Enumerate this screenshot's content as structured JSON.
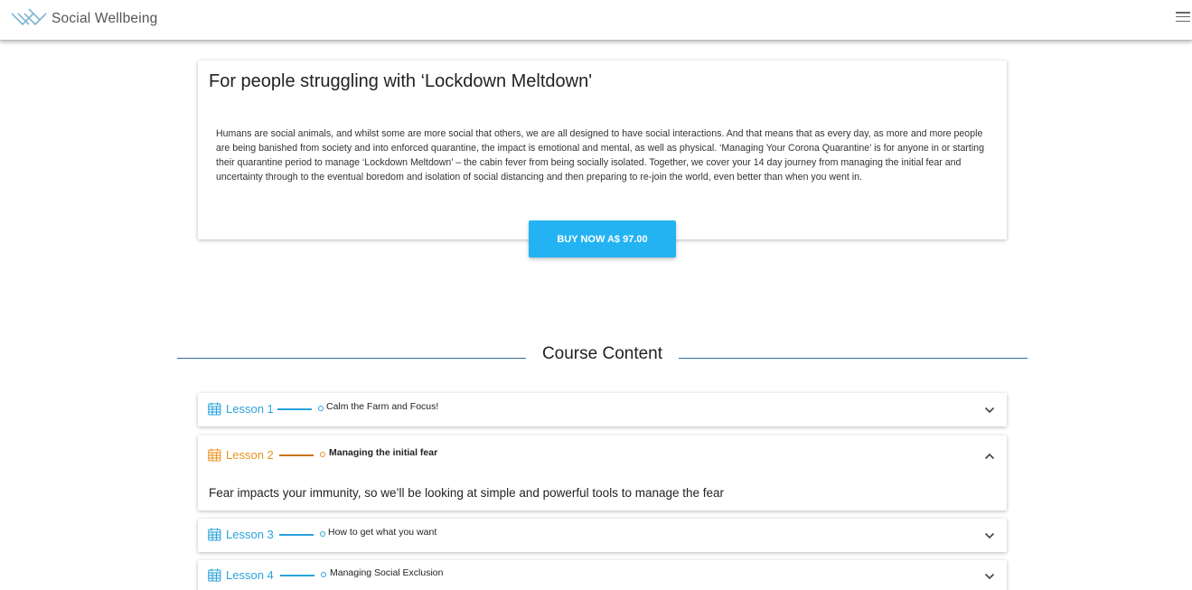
{
  "header": {
    "brand": "Social Wellbeing",
    "logo_icon": "interlocking-chevrons-logo",
    "menu_icon": "hamburger-menu-icon"
  },
  "promo": {
    "title": "For people struggling with ‘Lockdown Meltdown'",
    "body": "Humans are social animals, and whilst some are more social that others, we are all designed to have social interactions. And that means that as every day, as more and more people are being banished from society and into enforced quarantine, the impact is emotional and mental, as well as physical. ‘Managing Your Corona Quarantine’ is for anyone in or starting their quarantine period to manage ‘Lockdown Meltdown’ – the cabin fever from being socially isolated. Together, we cover your 14 day journey from managing the initial fear and uncertainty through to the eventual boredom and isolation of social distancing and then preparing to re-join the world, even better than when you went in.",
    "buy_label": "BUY NOW A$ 97.00"
  },
  "course": {
    "title": "Course Content",
    "lessons": [
      {
        "label": "Lesson 1",
        "title": "Calm the Farm and Focus!",
        "expanded": false,
        "color": "#2aa3dc",
        "icon": "calendar-icon"
      },
      {
        "label": "Lesson 2",
        "title": "Managing the initial fear",
        "expanded": true,
        "color": "#ec9420",
        "icon": "calendar-icon",
        "description": "Fear impacts your immunity, so we’ll be looking at simple and powerful tools to manage the fear"
      },
      {
        "label": "Lesson 3",
        "title": "How to get what you want",
        "expanded": false,
        "color": "#2aa3dc",
        "icon": "calendar-icon"
      },
      {
        "label": "Lesson 4",
        "title": "Managing Social Exclusion",
        "expanded": false,
        "color": "#2aa3dc",
        "icon": "calendar-icon"
      }
    ]
  },
  "colors": {
    "accent": "#24b3f2",
    "lesson_blue": "#2aa3dc",
    "lesson_orange": "#ec9420",
    "divider": "#2f6fa8"
  }
}
